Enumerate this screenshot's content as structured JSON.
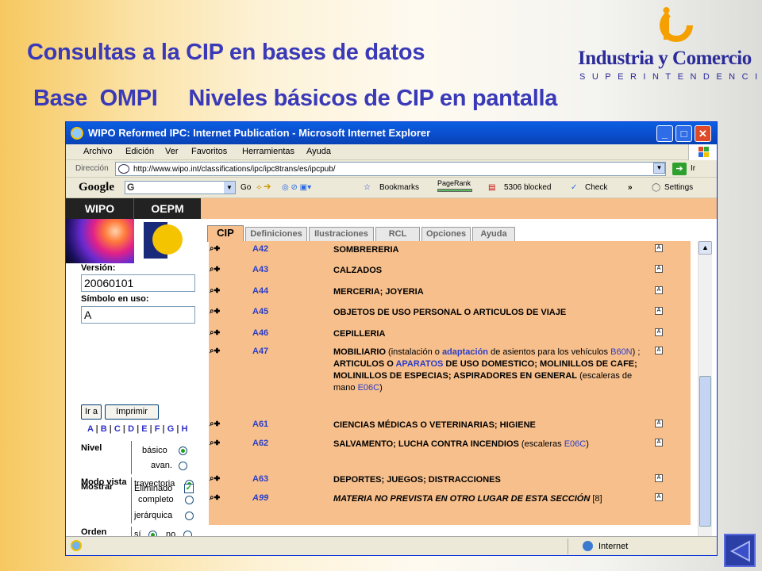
{
  "slide": {
    "title_line1": "Consultas a  la CIP en bases de datos",
    "title_line2": "Base  OMPI     Niveles básicos de CIP en pantalla"
  },
  "logo": {
    "name": "Industria y Comercio",
    "subtitle": "SUPERINTENDENCIA",
    "brand_color": "#2b2b9a",
    "accent_color": "#f5a000"
  },
  "browser": {
    "window_title": "WIPO Reformed IPC: Internet Publication - Microsoft Internet Explorer",
    "menu": [
      "Archivo",
      "Edición",
      "Ver",
      "Favoritos",
      "Herramientas",
      "Ayuda"
    ],
    "address_label": "Dirección",
    "address_url": "http://www.wipo.int/classifications/ipc/ipc8trans/es/ipcpub/",
    "go_label": "Ir",
    "toolbar": {
      "google_logo": "Google",
      "search_prefix": "G",
      "go": "Go",
      "bookmarks": "Bookmarks",
      "pagerank": "PageRank",
      "blocked": "5306 blocked",
      "check": "Check",
      "more": "»",
      "settings": "Settings"
    },
    "status": {
      "zone": "Internet"
    }
  },
  "page": {
    "header": {
      "wipo": "WIPO",
      "oepm": "OEPM"
    },
    "sidebar": {
      "version_label": "Versión:",
      "version_value": "20060101",
      "symbol_label": "Símbolo en uso:",
      "symbol_value": "A",
      "go_button": "Ir a",
      "print_button": "Imprimir",
      "letters": [
        "A",
        "B",
        "C",
        "D",
        "E",
        "F",
        "G",
        "H"
      ],
      "nivel": {
        "label": "Nivel",
        "options": [
          "básico",
          "avan."
        ],
        "selected": 0
      },
      "modo": {
        "label": "Modo vista",
        "options": [
          "trayectoria",
          "completo",
          "jerárquica"
        ],
        "selected": 0
      },
      "orden": {
        "label": "Orden norm.",
        "options": [
          "sí",
          "no"
        ],
        "selected": 0
      },
      "mostrar": {
        "label": "Mostrar",
        "option": "Eliminado",
        "checked": true
      }
    },
    "tabs": [
      "CIP",
      "Definiciones",
      "Ilustraciones",
      "RCL",
      "Opciones",
      "Ayuda"
    ],
    "active_tab": 0,
    "row_icons": "⌕✚",
    "badge": "A",
    "entries": [
      {
        "code": "A42",
        "title": "SOMBRERERIA"
      },
      {
        "code": "A43",
        "title": "CALZADOS"
      },
      {
        "code": "A44",
        "title": "MERCERIA; JOYERIA"
      },
      {
        "code": "A45",
        "title": "OBJETOS DE USO PERSONAL O ARTICULOS DE VIAJE"
      },
      {
        "code": "A46",
        "title": "CEPILLERIA"
      },
      {
        "code": "A47",
        "t1": "MOBILIARIO",
        "t2": " (instalación o ",
        "t3": "adaptación",
        "t4": " de asientos para los vehículos ",
        "t5": "B60N",
        "t6": ") ; ",
        "t7": "ARTICULOS O ",
        "t8": "APARATOS",
        "t9": " DE USO DOMESTICO; MOLINILLOS DE CAFE; MOLINILLOS DE ESPECIAS; ASPIRADORES EN GENERAL",
        "t10": " (escaleras de mano ",
        "t11": "E06C",
        "t12": ")"
      },
      {
        "code": "A61",
        "title": "CIENCIAS MÉDICAS O VETERINARIAS; HIGIENE"
      },
      {
        "code": "A62",
        "t1": "SALVAMENTO; LUCHA CONTRA INCENDIOS",
        "t2": " (escaleras ",
        "t3": "E06C",
        "t4": ")"
      },
      {
        "code": "A63",
        "title": "DEPORTES; JUEGOS; DISTRACCIONES"
      },
      {
        "code": "A99",
        "title": "MATERIA NO PREVISTA EN OTRO LUGAR DE ESTA SECCIÓN",
        "suffix": " [8]"
      }
    ]
  },
  "colors": {
    "title_blue": "#3a3ab8",
    "xp_blue": "#0b4fd0",
    "content_bg": "#f7bf8c",
    "link_blue": "#2a3ec8"
  }
}
